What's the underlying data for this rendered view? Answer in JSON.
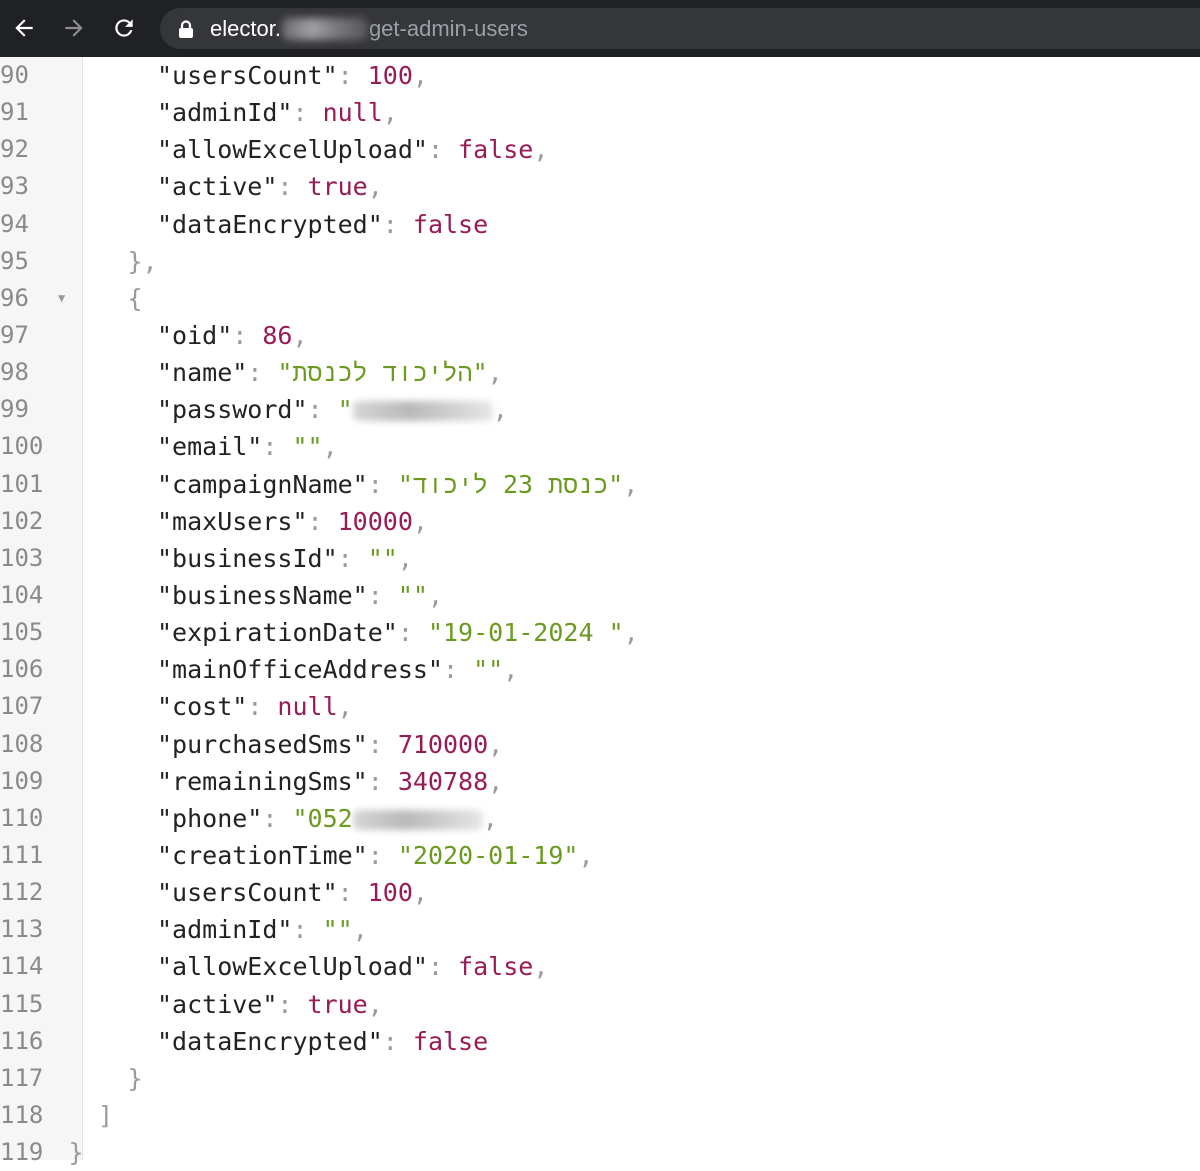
{
  "browser": {
    "url_host": "elector.",
    "url_path": "get-admin-users"
  },
  "lines": [
    {
      "n": "90",
      "indent": 3,
      "key": "usersCount",
      "type": "num",
      "value": "100",
      "comma": true
    },
    {
      "n": "91",
      "indent": 3,
      "key": "adminId",
      "type": "kw",
      "value": "null",
      "comma": true
    },
    {
      "n": "92",
      "indent": 3,
      "key": "allowExcelUpload",
      "type": "kw",
      "value": "false",
      "comma": true
    },
    {
      "n": "93",
      "indent": 3,
      "key": "active",
      "type": "kw",
      "value": "true",
      "comma": true
    },
    {
      "n": "94",
      "indent": 3,
      "key": "dataEncrypted",
      "type": "kw",
      "value": "false",
      "comma": false
    },
    {
      "n": "95",
      "indent": 2,
      "punct": "},"
    },
    {
      "n": "96",
      "indent": 2,
      "punct": "{",
      "fold": "▼"
    },
    {
      "n": "97",
      "indent": 3,
      "key": "oid",
      "type": "num",
      "value": "86",
      "comma": true
    },
    {
      "n": "98",
      "indent": 3,
      "key": "name",
      "type": "str",
      "value": "הליכוד לכנסת",
      "rtl": true,
      "comma": true
    },
    {
      "n": "99",
      "indent": 3,
      "key": "password",
      "type": "redacted",
      "value": "",
      "blur": "pass",
      "comma": true
    },
    {
      "n": "100",
      "indent": 3,
      "key": "email",
      "type": "str",
      "value": "",
      "comma": true
    },
    {
      "n": "101",
      "indent": 3,
      "key": "campaignName",
      "type": "str",
      "value": "כנסת 23 ליכוד",
      "rtl": true,
      "comma": true
    },
    {
      "n": "102",
      "indent": 3,
      "key": "maxUsers",
      "type": "num",
      "value": "10000",
      "comma": true
    },
    {
      "n": "103",
      "indent": 3,
      "key": "businessId",
      "type": "str",
      "value": "",
      "comma": true
    },
    {
      "n": "104",
      "indent": 3,
      "key": "businessName",
      "type": "str",
      "value": "",
      "comma": true
    },
    {
      "n": "105",
      "indent": 3,
      "key": "expirationDate",
      "type": "str",
      "value": "19-01-2024 ",
      "comma": true
    },
    {
      "n": "106",
      "indent": 3,
      "key": "mainOfficeAddress",
      "type": "str",
      "value": "",
      "comma": true
    },
    {
      "n": "107",
      "indent": 3,
      "key": "cost",
      "type": "kw",
      "value": "null",
      "comma": true
    },
    {
      "n": "108",
      "indent": 3,
      "key": "purchasedSms",
      "type": "num",
      "value": "710000",
      "comma": true
    },
    {
      "n": "109",
      "indent": 3,
      "key": "remainingSms",
      "type": "num",
      "value": "340788",
      "comma": true
    },
    {
      "n": "110",
      "indent": 3,
      "key": "phone",
      "type": "redacted",
      "value": "052",
      "blur": "phone",
      "comma": true
    },
    {
      "n": "111",
      "indent": 3,
      "key": "creationTime",
      "type": "str",
      "value": "2020-01-19",
      "comma": true
    },
    {
      "n": "112",
      "indent": 3,
      "key": "usersCount",
      "type": "num",
      "value": "100",
      "comma": true
    },
    {
      "n": "113",
      "indent": 3,
      "key": "adminId",
      "type": "str",
      "value": "",
      "comma": true
    },
    {
      "n": "114",
      "indent": 3,
      "key": "allowExcelUpload",
      "type": "kw",
      "value": "false",
      "comma": true
    },
    {
      "n": "115",
      "indent": 3,
      "key": "active",
      "type": "kw",
      "value": "true",
      "comma": true
    },
    {
      "n": "116",
      "indent": 3,
      "key": "dataEncrypted",
      "type": "kw",
      "value": "false",
      "comma": false
    },
    {
      "n": "117",
      "indent": 2,
      "punct": "}"
    },
    {
      "n": "118",
      "indent": 1,
      "punct": "]"
    },
    {
      "n": "119",
      "indent": 0,
      "punct": "}"
    }
  ],
  "colors": {
    "key": "#222222",
    "number": "#981b56",
    "string": "#6a9a1f",
    "punctuation": "#9a9a9a",
    "chrome": "#202124"
  }
}
